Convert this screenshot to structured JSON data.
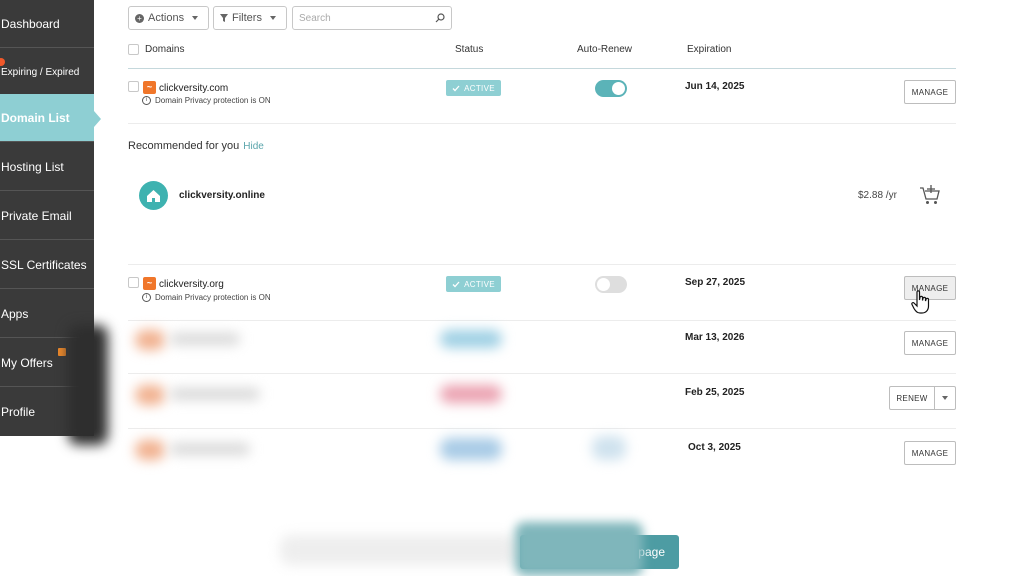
{
  "sidebar": {
    "items": [
      {
        "label": "Dashboard"
      },
      {
        "label": "Expiring / Expired"
      },
      {
        "label": "Domain List"
      },
      {
        "label": "Hosting List"
      },
      {
        "label": "Private Email"
      },
      {
        "label": "SSL Certificates"
      },
      {
        "label": "Apps"
      },
      {
        "label": "My Offers"
      },
      {
        "label": "Profile"
      }
    ]
  },
  "toolbar": {
    "actions_label": "Actions",
    "filters_label": "Filters",
    "search_placeholder": "Search"
  },
  "table": {
    "headers": {
      "domains": "Domains",
      "status": "Status",
      "auto_renew": "Auto-Renew",
      "expiration": "Expiration"
    },
    "rows": [
      {
        "domain": "clickversity.com",
        "privacy": "Domain Privacy protection is ON",
        "status": "ACTIVE",
        "auto_renew": true,
        "expiration": "Jun 14, 2025",
        "action": "MANAGE"
      },
      {
        "domain": "clickversity.org",
        "privacy": "Domain Privacy protection is ON",
        "status": "ACTIVE",
        "auto_renew": false,
        "expiration": "Sep 27, 2025",
        "action": "MANAGE"
      },
      {
        "domain": "",
        "expiration": "Mar 13, 2026",
        "action": "MANAGE"
      },
      {
        "domain": "",
        "expiration": "Feb 25, 2025",
        "action": "RENEW"
      },
      {
        "domain": "",
        "expiration": "Oct 3, 2025",
        "action": "MANAGE"
      }
    ]
  },
  "recommended": {
    "title": "Recommended for you",
    "hide_label": "Hide",
    "domain": "clickversity.online",
    "price": "$2.88 /yr"
  },
  "footer": {
    "cta_label": "page"
  },
  "colors": {
    "sidebar_bg": "#3a3a3a",
    "accent": "#8ecfd3",
    "toggle_on": "#5bb3b8",
    "logo_orange": "#f0762a"
  }
}
